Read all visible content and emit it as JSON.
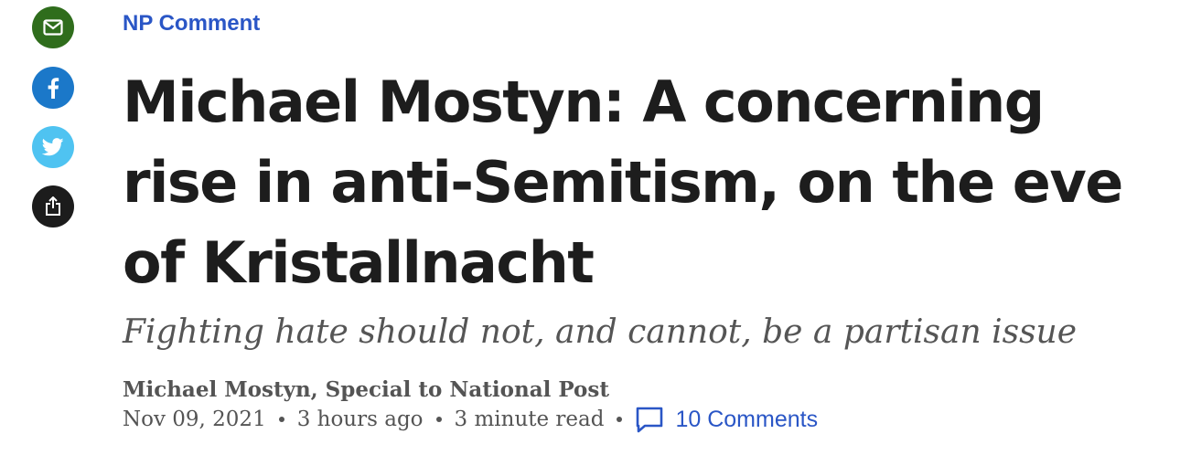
{
  "share_bar": {
    "items": [
      {
        "name": "email",
        "icon": "envelope-icon",
        "color": "#2f6d1c"
      },
      {
        "name": "facebook",
        "icon": "facebook-icon",
        "color": "#1b78c9"
      },
      {
        "name": "twitter",
        "icon": "twitter-bird-icon",
        "color": "#4fc3f1"
      },
      {
        "name": "share",
        "icon": "share-upload-icon",
        "color": "#1c1c1c"
      }
    ]
  },
  "article": {
    "category": "NP Comment",
    "headline": "Michael Mostyn: A concerning rise in anti-Semitism, on the eve of Kristallnacht",
    "subheadline": "Fighting hate should not, and cannot, be a partisan issue",
    "byline": "Michael Mostyn, Special to National Post",
    "date": "Nov 09, 2021",
    "time_ago": "3 hours ago",
    "read_time": "3 minute read",
    "comments_label": "10 Comments"
  },
  "colors": {
    "accent_link": "#2a56c6",
    "headline_text": "#1d1d1d",
    "meta_text": "#545454",
    "subhead_text": "#555555"
  }
}
